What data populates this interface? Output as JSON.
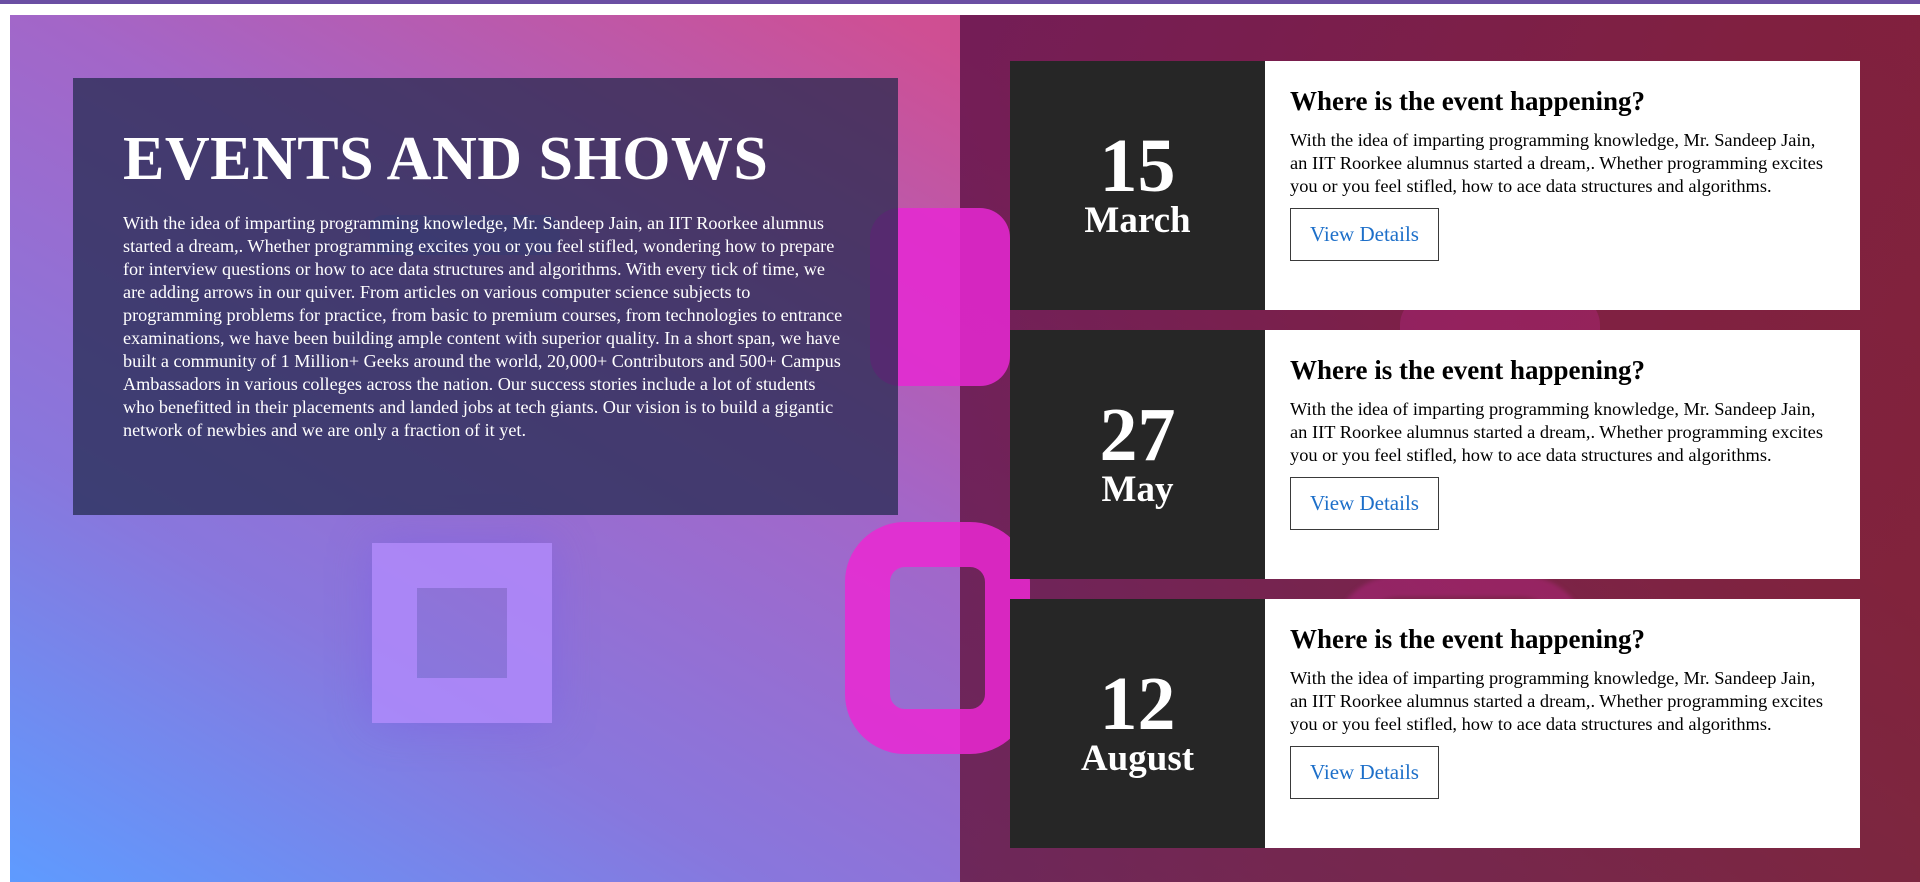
{
  "hero": {
    "title": "EVENTS AND SHOWS",
    "body": "With the idea of imparting programming knowledge, Mr. Sandeep Jain, an IIT Roorkee alumnus started a dream,. Whether programming excites you or you feel stifled, wondering how to prepare for interview questions or how to ace data structures and algorithms. With every tick of time, we are adding arrows in our quiver. From articles on various computer science subjects to programming problems for practice, from basic to premium courses, from technologies to entrance examinations, we have been building ample content with superior quality. In a short span, we have built a community of 1 Million+ Geeks around the world, 20,000+ Contributors and 500+ Campus Ambassadors in various colleges across the nation. Our success stories include a lot of students who benefitted in their placements and landed jobs at tech giants. Our vision is to build a gigantic network of newbies and we are only a fraction of it yet."
  },
  "events": [
    {
      "day": "15",
      "month": "March",
      "title": "Where is the event happening?",
      "description": "With the idea of imparting programming knowledge, Mr. Sandeep Jain, an IIT Roorkee alumnus started a dream,. Whether programming excites you or you feel stifled, how to ace data structures and algorithms.",
      "button_label": "View Details"
    },
    {
      "day": "27",
      "month": "May",
      "title": "Where is the event happening?",
      "description": "With the idea of imparting programming knowledge, Mr. Sandeep Jain, an IIT Roorkee alumnus started a dream,. Whether programming excites you or you feel stifled, how to ace data structures and algorithms.",
      "button_label": "View Details"
    },
    {
      "day": "12",
      "month": "August",
      "title": "Where is the event happening?",
      "description": "With the idea of imparting programming knowledge, Mr. Sandeep Jain, an IIT Roorkee alumnus started a dream,. Whether programming excites you or you feel stifled, how to ace data structures and algorithms.",
      "button_label": "View Details"
    }
  ],
  "colors": {
    "date_box": "#262626",
    "button_text": "#1d6fc9",
    "accent_pink": "#e628d2",
    "gradient_blue": "#5e9bff",
    "gradient_pink": "#d34a82"
  }
}
